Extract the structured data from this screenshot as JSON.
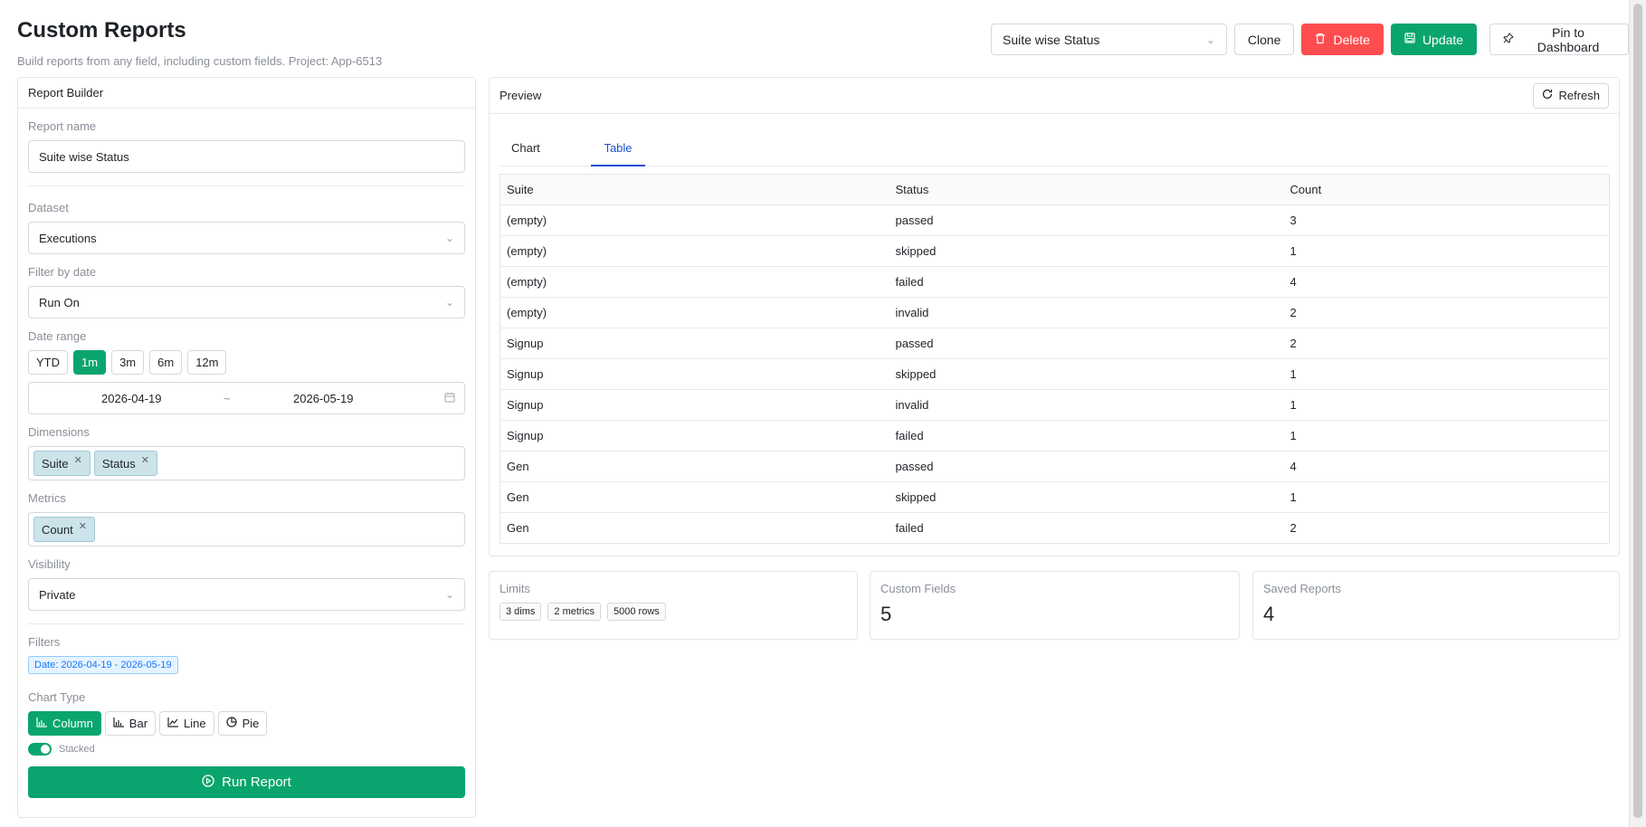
{
  "header": {
    "title": "Custom Reports",
    "subtitle": "Build reports from any field, including custom fields. Project: App-6513"
  },
  "toolbar": {
    "selected_report": "Suite wise Status",
    "clone_label": "Clone",
    "delete_label": "Delete",
    "update_label": "Update",
    "pin_label": "Pin to Dashboard"
  },
  "builder": {
    "title": "Report Builder",
    "report_name_label": "Report name",
    "report_name_value": "Suite wise Status",
    "dataset_label": "Dataset",
    "dataset_value": "Executions",
    "filter_by_date_label": "Filter by date",
    "filter_by_date_value": "Run On",
    "date_range_label": "Date range",
    "date_presets": [
      "YTD",
      "1m",
      "3m",
      "6m",
      "12m"
    ],
    "active_preset": "1m",
    "date_start": "2026-04-19",
    "date_sep": "~",
    "date_end": "2026-05-19",
    "dimensions_label": "Dimensions",
    "dimensions": [
      "Suite",
      "Status"
    ],
    "metrics_label": "Metrics",
    "metrics": [
      "Count"
    ],
    "visibility_label": "Visibility",
    "visibility_value": "Private",
    "filters_label": "Filters",
    "filter_tag": "Date: 2026-04-19 - 2026-05-19",
    "chart_type_label": "Chart Type",
    "chart_types": [
      "Column",
      "Bar",
      "Line",
      "Pie"
    ],
    "active_chart_type": "Column",
    "stacked_label": "Stacked",
    "stacked": true,
    "run_label": "Run Report"
  },
  "preview": {
    "title": "Preview",
    "refresh_label": "Refresh",
    "tabs": [
      "Chart",
      "Table"
    ],
    "active_tab": "Table",
    "columns": [
      "Suite",
      "Status",
      "Count"
    ],
    "rows": [
      [
        "(empty)",
        "passed",
        "3"
      ],
      [
        "(empty)",
        "skipped",
        "1"
      ],
      [
        "(empty)",
        "failed",
        "4"
      ],
      [
        "(empty)",
        "invalid",
        "2"
      ],
      [
        "Signup",
        "passed",
        "2"
      ],
      [
        "Signup",
        "skipped",
        "1"
      ],
      [
        "Signup",
        "invalid",
        "1"
      ],
      [
        "Signup",
        "failed",
        "1"
      ],
      [
        "Gen",
        "passed",
        "4"
      ],
      [
        "Gen",
        "skipped",
        "1"
      ],
      [
        "Gen",
        "failed",
        "2"
      ]
    ]
  },
  "stats": {
    "limits_label": "Limits",
    "limits": [
      "3 dims",
      "2 metrics",
      "5000 rows"
    ],
    "custom_fields_label": "Custom Fields",
    "custom_fields_value": "5",
    "saved_reports_label": "Saved Reports",
    "saved_reports_value": "4"
  },
  "colors": {
    "accent_green": "#0aa56e",
    "danger_red": "#ff4d4f",
    "tab_blue": "#1d4fd8",
    "tag_bg": "#cce3ea"
  }
}
